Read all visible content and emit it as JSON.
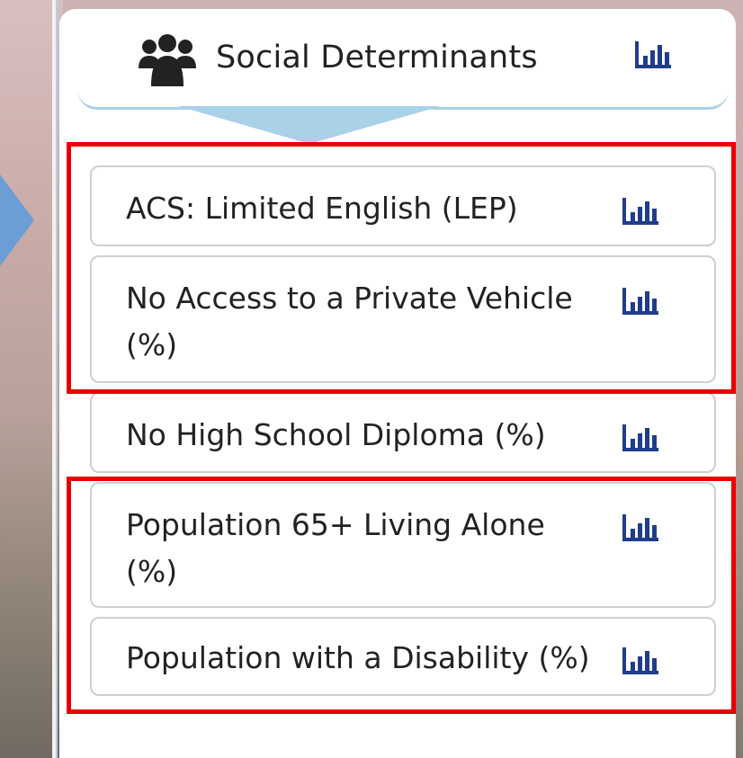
{
  "panel": {
    "title": "Social Determinants",
    "title_icon": "people-group-icon",
    "chart_icon": "bar-chart-icon"
  },
  "items": [
    {
      "label": "ACS: Limited English (LEP)",
      "highlighted": true
    },
    {
      "label": "No Access to a Private Vehicle (%)",
      "highlighted": true
    },
    {
      "label": "No High School Diploma (%)",
      "highlighted": false
    },
    {
      "label": "Population 65+ Living Alone (%)",
      "highlighted": true
    },
    {
      "label": "Population with a Disability (%)",
      "highlighted": true
    }
  ],
  "colors": {
    "highlight": "#e80000",
    "accent": "#a9d1e8",
    "link_icon": "#1f3d8a",
    "arrow": "#6b9ed6"
  }
}
